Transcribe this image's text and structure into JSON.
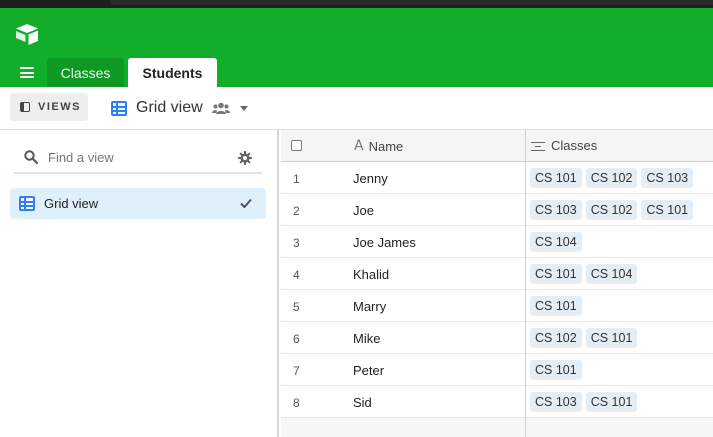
{
  "colors": {
    "header": "#12ad2b",
    "accent_blue": "#2d7ff9",
    "selected_view_bg": "#e0f0fb",
    "chip_bg": "#e5edf5"
  },
  "header": {
    "logo_icon": "airtable-logo-icon",
    "menu_icon": "hamburger-menu-icon",
    "tabs": [
      {
        "label": "Classes",
        "active": false
      },
      {
        "label": "Students",
        "active": true
      }
    ]
  },
  "viewbar": {
    "views_label": "VIEWS",
    "current_view": "Grid view",
    "view_icon": "grid-icon",
    "collab_icon": "people-icon"
  },
  "sidebar": {
    "search_placeholder": "Find a view",
    "views": [
      {
        "label": "Grid view",
        "selected": true
      }
    ]
  },
  "grid": {
    "columns": [
      {
        "label": "Name",
        "icon": "text-field-icon"
      },
      {
        "label": "Classes",
        "icon": "linked-record-icon"
      }
    ],
    "rows": [
      {
        "num": "1",
        "name": "Jenny",
        "classes": [
          "CS 101",
          "CS 102",
          "CS 103"
        ]
      },
      {
        "num": "2",
        "name": "Joe",
        "classes": [
          "CS 103",
          "CS 102",
          "CS 101"
        ]
      },
      {
        "num": "3",
        "name": "Joe James",
        "classes": [
          "CS 104"
        ]
      },
      {
        "num": "4",
        "name": "Khalid",
        "classes": [
          "CS 101",
          "CS 104"
        ]
      },
      {
        "num": "5",
        "name": "Marry",
        "classes": [
          "CS 101"
        ]
      },
      {
        "num": "6",
        "name": "Mike",
        "classes": [
          "CS 102",
          "CS 101"
        ]
      },
      {
        "num": "7",
        "name": "Peter",
        "classes": [
          "CS 101"
        ]
      },
      {
        "num": "8",
        "name": "Sid",
        "classes": [
          "CS 103",
          "CS 101"
        ]
      }
    ]
  }
}
